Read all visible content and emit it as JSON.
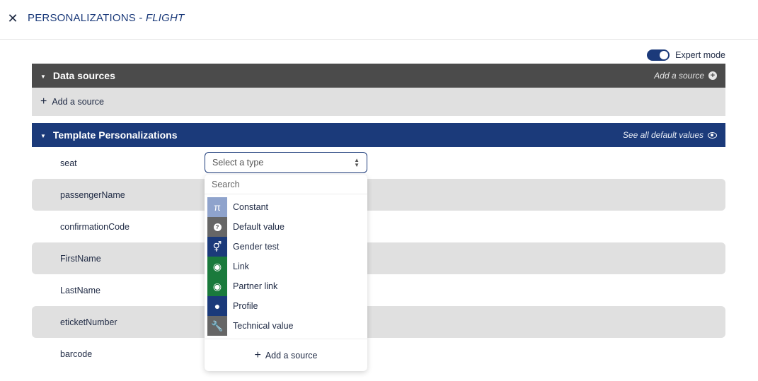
{
  "header": {
    "title": "PERSONALIZATIONS - ",
    "subtitle": "FLIGHT",
    "close_glyph": "✕"
  },
  "expert_mode": {
    "label": "Expert mode",
    "enabled": true
  },
  "data_sources": {
    "title": "Data sources",
    "action_label": "Add a source",
    "add_label": "Add a source"
  },
  "template": {
    "title": "Template Personalizations",
    "action_label": "See all default values"
  },
  "fields": [
    {
      "name": "seat"
    },
    {
      "name": "passengerName"
    },
    {
      "name": "confirmationCode"
    },
    {
      "name": "FirstName"
    },
    {
      "name": "LastName"
    },
    {
      "name": "eticketNumber"
    },
    {
      "name": "barcode"
    }
  ],
  "type_select": {
    "placeholder": "Select a type"
  },
  "dropdown": {
    "search_placeholder": "Search",
    "items": [
      {
        "label": "Constant",
        "icon": "pi-icon",
        "glyph": "π",
        "color": "#8fa3cc"
      },
      {
        "label": "Default value",
        "icon": "question-icon",
        "glyph": "?",
        "color": "#666666"
      },
      {
        "label": "Gender test",
        "icon": "gender-icon",
        "glyph": "⚥",
        "color": "#1b3a7a"
      },
      {
        "label": "Link",
        "icon": "globe-icon",
        "glyph": "◉",
        "color": "#1a7a3c"
      },
      {
        "label": "Partner link",
        "icon": "globe-icon",
        "glyph": "◉",
        "color": "#1a7a3c"
      },
      {
        "label": "Profile",
        "icon": "person-icon",
        "glyph": "●",
        "color": "#1b3a7a"
      },
      {
        "label": "Technical value",
        "icon": "wrench-icon",
        "glyph": "🔧",
        "color": "#666666"
      }
    ],
    "footer_label": "Add a source"
  }
}
